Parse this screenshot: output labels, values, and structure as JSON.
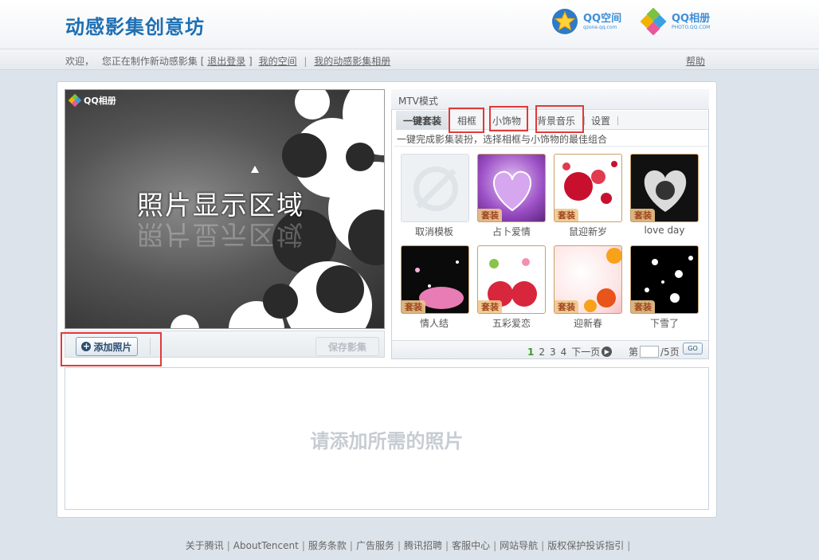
{
  "header": {
    "site_title": "动感影集创意坊",
    "qzone_logo": {
      "main": "QQ空间",
      "sub": "qzone.qq.com"
    },
    "photo_logo": {
      "main": "QQ相册",
      "sub": "PHOTO.QQ.COM"
    }
  },
  "nav": {
    "welcome": "欢迎，",
    "status": "您正在制作新动感影集",
    "bracket_open": "[",
    "logout": "退出登录",
    "bracket_close": "]",
    "my_space": "我的空间",
    "sep": "|",
    "my_album": "我的动感影集相册",
    "help": "帮助"
  },
  "preview": {
    "badge": "QQ相册",
    "display_text": "照片显示区域"
  },
  "toolbar": {
    "add_photo": "添加照片",
    "save_album": "保存影集"
  },
  "side_panel": {
    "mode_title": "MTV模式",
    "tabs": [
      {
        "label": "一键套装"
      },
      {
        "label": "相框"
      },
      {
        "label": "小饰物"
      },
      {
        "label": "背景音乐"
      },
      {
        "label": "设置"
      }
    ],
    "description": "一键完成影集装扮，选择相框与小饰物的最佳组合",
    "tag_label": "套装",
    "templates": [
      {
        "name": "取消模板"
      },
      {
        "name": "占卜爱情"
      },
      {
        "name": "鼠迎新岁"
      },
      {
        "name": "love day"
      },
      {
        "name": "情人结"
      },
      {
        "name": "五彩爱恋"
      },
      {
        "name": "迎新春"
      },
      {
        "name": "下雪了"
      }
    ]
  },
  "pager": {
    "pages": [
      "1",
      "2",
      "3",
      "4"
    ],
    "next": "下一页",
    "jump_prefix": "第",
    "jump_suffix": "/5页",
    "go": "GO"
  },
  "drop_area": {
    "hint": "请添加所需的照片"
  },
  "footer": {
    "links": [
      "关于腾讯",
      "AboutTencent",
      "服务条款",
      "广告服务",
      "腾讯招聘",
      "客服中心",
      "网站导航",
      "版权保护投诉指引"
    ],
    "sep": "|"
  },
  "colors": {
    "brand_blue": "#1e6fb3",
    "highlight_red": "#e03a3a",
    "page_current_green": "#3c9a2e"
  }
}
